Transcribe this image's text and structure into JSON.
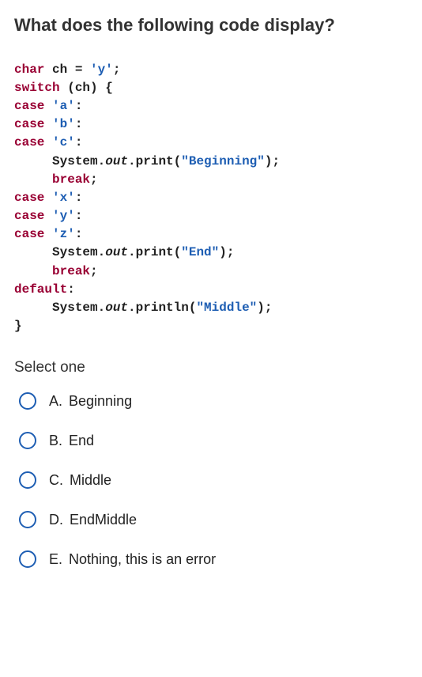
{
  "question": {
    "title": "What does the following code display?"
  },
  "code": {
    "line1_a": "char",
    "line1_b": " ch = ",
    "line1_c": "'y'",
    "line1_d": ";",
    "line2_a": "switch",
    "line2_b": " (ch) {",
    "line3_a": "case ",
    "line3_b": "'a'",
    "line3_c": ":",
    "line4_a": "case ",
    "line4_b": "'b'",
    "line4_c": ":",
    "line5_a": "case ",
    "line5_b": "'c'",
    "line5_c": ":",
    "line6_a": "     System.",
    "line6_b": "out",
    "line6_c": ".print(",
    "line6_d": "\"Beginning\"",
    "line6_e": ");",
    "line7_a": "     ",
    "line7_b": "break",
    "line7_c": ";",
    "line8_a": "case ",
    "line8_b": "'x'",
    "line8_c": ":",
    "line9_a": "case ",
    "line9_b": "'y'",
    "line9_c": ":",
    "line10_a": "case ",
    "line10_b": "'z'",
    "line10_c": ":",
    "line11_a": "     System.",
    "line11_b": "out",
    "line11_c": ".print(",
    "line11_d": "\"End\"",
    "line11_e": ");",
    "line12_a": "     ",
    "line12_b": "break",
    "line12_c": ";",
    "line13_a": "default",
    "line13_b": ":",
    "line14_a": "     System.",
    "line14_b": "out",
    "line14_c": ".println(",
    "line14_d": "\"Middle\"",
    "line14_e": ");",
    "line15": "}"
  },
  "select_label": "Select one",
  "options": [
    {
      "letter": "A.",
      "text": "Beginning"
    },
    {
      "letter": "B.",
      "text": "End"
    },
    {
      "letter": "C.",
      "text": "Middle"
    },
    {
      "letter": "D.",
      "text": "EndMiddle"
    },
    {
      "letter": "E.",
      "text": "Nothing, this is an error"
    }
  ]
}
